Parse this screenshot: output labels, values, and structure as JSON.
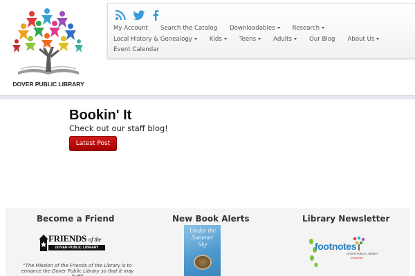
{
  "header": {
    "library_name": "DOVER PUBLIC LIBRARY"
  },
  "social": {
    "icons": [
      "rss-icon",
      "twitter-icon",
      "facebook-icon"
    ],
    "color": "#3a9bd8"
  },
  "nav": {
    "row1": [
      {
        "label": "My Account",
        "dropdown": false
      },
      {
        "label": "Search the Catalog",
        "dropdown": false
      },
      {
        "label": "Downloadables",
        "dropdown": true
      },
      {
        "label": "Research",
        "dropdown": true
      }
    ],
    "row2": [
      {
        "label": "Local History & Genealogy",
        "dropdown": true
      },
      {
        "label": "Kids",
        "dropdown": true
      },
      {
        "label": "Teens",
        "dropdown": true
      },
      {
        "label": "Adults",
        "dropdown": true
      },
      {
        "label": "Our Blog",
        "dropdown": false
      },
      {
        "label": "About Us",
        "dropdown": true
      }
    ],
    "row3": [
      {
        "label": "Event Calendar",
        "dropdown": false
      }
    ]
  },
  "hero": {
    "title": "Bookin' It",
    "subtitle": "Check out our staff blog!",
    "button_label": "Latest Post",
    "button_color": "#c00000"
  },
  "panels": {
    "friend": {
      "title": "Become a Friend",
      "logo_main": "FRIENDS",
      "logo_of": "of the",
      "logo_sub": "DOVER PUBLIC LIBRARY",
      "mission": "\"The Mission of the Friends of the Library is to enhance the Dover Public Library so that it may fulfill"
    },
    "alerts": {
      "title": "New Book Alerts",
      "book_title": "Under the Summer Sky"
    },
    "newsletter": {
      "title": "Library Newsletter",
      "logo_text": "footnotes",
      "logo_sub": "DOVER PUBLIC LIBRARY",
      "logo_sub2": "newsletter"
    }
  }
}
